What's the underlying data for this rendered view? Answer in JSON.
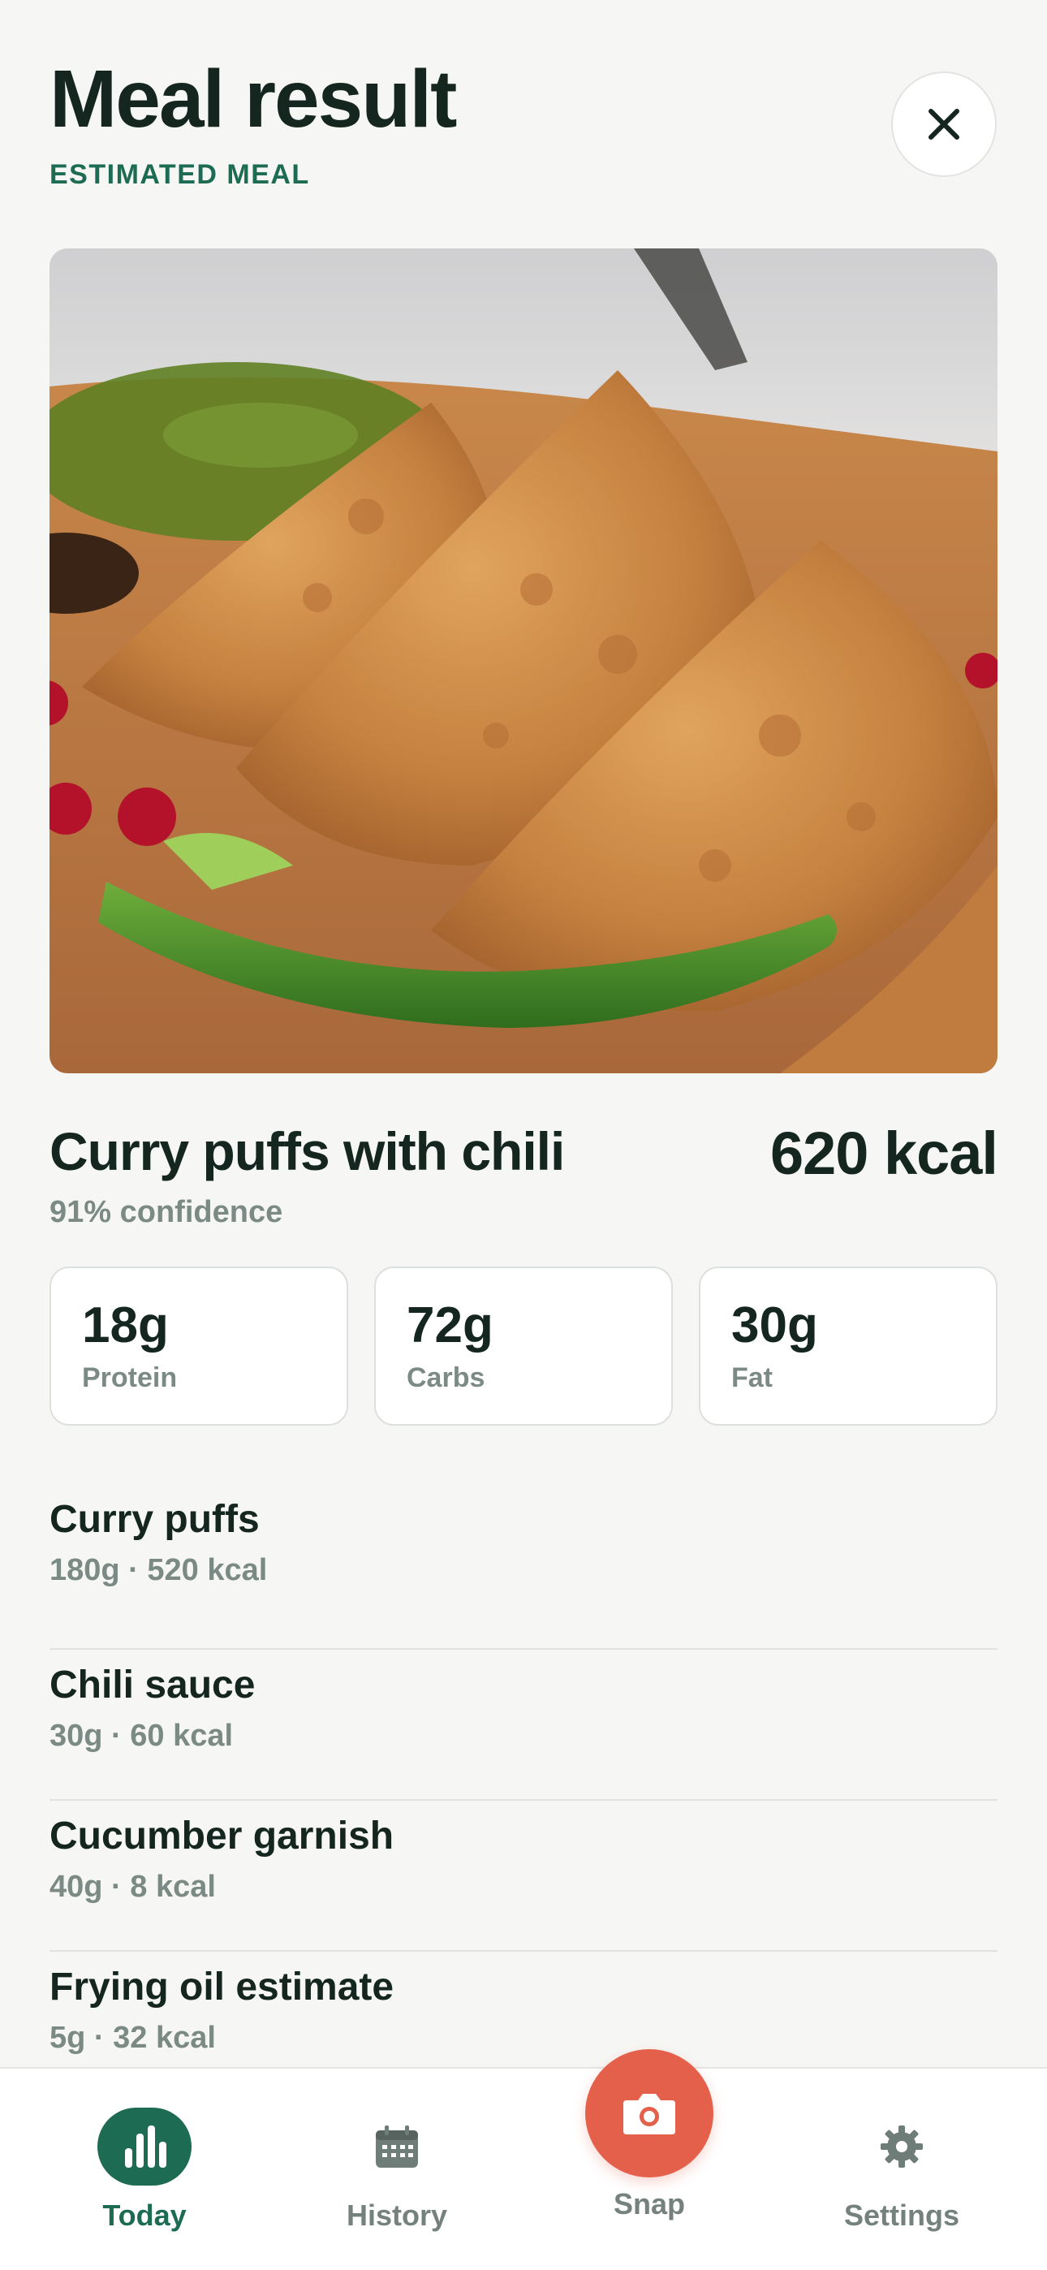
{
  "header": {
    "title": "Meal result",
    "subtitle": "ESTIMATED MEAL",
    "close_icon": "close-icon"
  },
  "photo": {
    "alt": "Curry puffs with chili"
  },
  "summary": {
    "meal_name": "Curry puffs with chili",
    "kcal": "620 kcal",
    "confidence": "91% confidence"
  },
  "macros": [
    {
      "value": "18g",
      "label": "Protein"
    },
    {
      "value": "72g",
      "label": "Carbs"
    },
    {
      "value": "30g",
      "label": "Fat"
    }
  ],
  "items": [
    {
      "name": "Curry puffs",
      "meta": "180g · 520 kcal"
    },
    {
      "name": "Chili sauce",
      "meta": "30g · 60 kcal"
    },
    {
      "name": "Cucumber garnish",
      "meta": "40g · 8 kcal"
    },
    {
      "name": "Frying oil estimate",
      "meta": "5g · 32 kcal"
    }
  ],
  "tabbar": {
    "today": {
      "label": "Today",
      "icon": "bar-chart-icon",
      "active": true
    },
    "history": {
      "label": "History",
      "icon": "calendar-icon"
    },
    "snap": {
      "label": "Snap",
      "icon": "camera-icon"
    },
    "settings": {
      "label": "Settings",
      "icon": "gear-icon"
    }
  },
  "colors": {
    "accent": "#1e6b54",
    "snap": "#e4604b",
    "text": "#14261f",
    "muted": "#7b8a84",
    "background": "#f6f7f5"
  }
}
